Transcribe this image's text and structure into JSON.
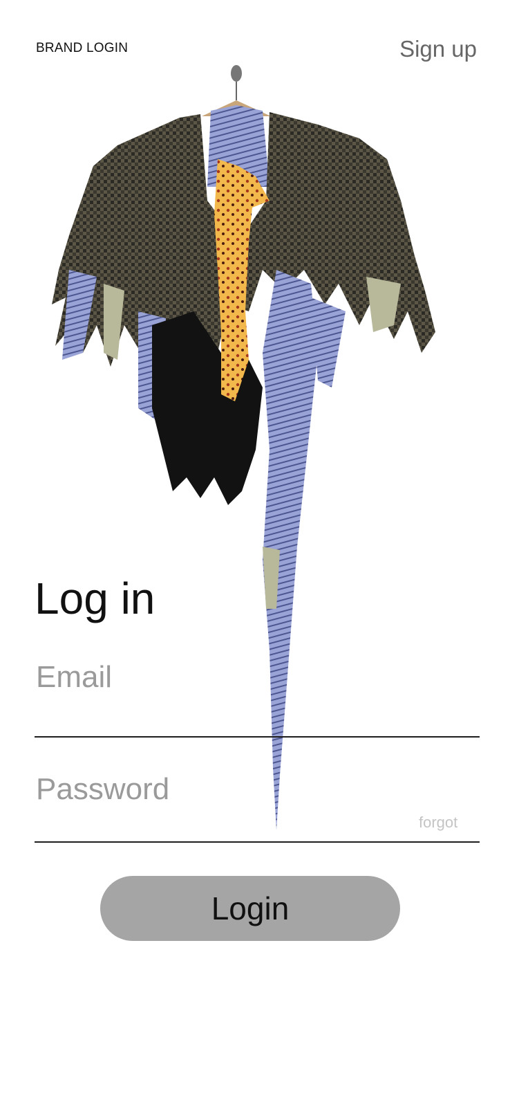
{
  "header": {
    "brand": "BRAND LOGIN",
    "signup_label": "Sign up"
  },
  "hero": {
    "description_icon": "distressed-jacket-on-hanger-image"
  },
  "form": {
    "title": "Log in",
    "email_placeholder": "Email",
    "email_value": "",
    "password_placeholder": "Password",
    "password_value": "",
    "forgot_label": "forgot",
    "login_label": "Login"
  },
  "colors": {
    "button_bg": "#a5a5a5",
    "placeholder": "#9a9a9a",
    "forgot": "#c4c4c4",
    "underline": "#1d1d1d"
  }
}
